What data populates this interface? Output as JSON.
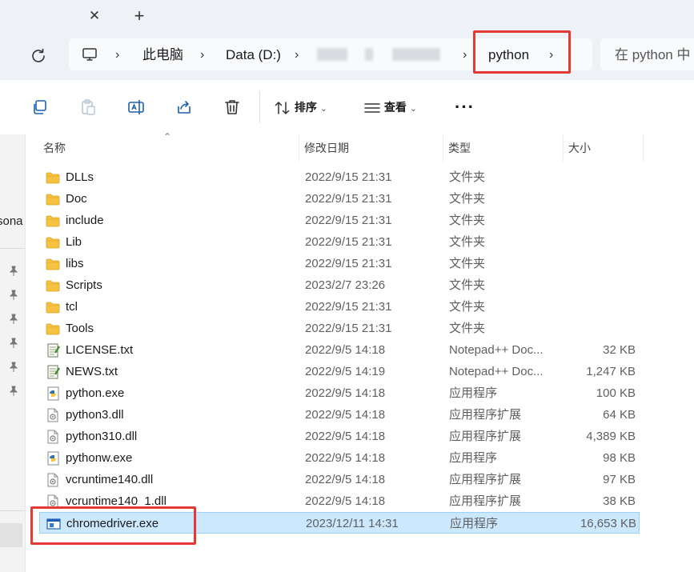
{
  "tabs": {
    "close_glyph": "✕",
    "new_glyph": "+"
  },
  "address": {
    "root_icon": "computer-icon",
    "crumbs": [
      "此电脑",
      "Data (D:)",
      "python"
    ],
    "separator": "›",
    "search_placeholder": "在 python 中"
  },
  "toolbar": {
    "buttons": [
      "copy-icon",
      "paste-icon",
      "rename-icon",
      "share-icon",
      "delete-icon"
    ],
    "sort_label": "排序",
    "view_label": "查看",
    "more_label": "···",
    "dropdown_glyph": "⌄"
  },
  "nav": {
    "partial_label": "sona"
  },
  "columns": {
    "name": "名称",
    "date": "修改日期",
    "type": "类型",
    "size": "大小",
    "sort_glyph": "⌃"
  },
  "files": [
    {
      "name": "DLLs",
      "date": "2022/9/15 21:31",
      "type": "文件夹",
      "size": "",
      "icon": "folder-icon"
    },
    {
      "name": "Doc",
      "date": "2022/9/15 21:31",
      "type": "文件夹",
      "size": "",
      "icon": "folder-icon"
    },
    {
      "name": "include",
      "date": "2022/9/15 21:31",
      "type": "文件夹",
      "size": "",
      "icon": "folder-icon"
    },
    {
      "name": "Lib",
      "date": "2022/9/15 21:31",
      "type": "文件夹",
      "size": "",
      "icon": "folder-icon"
    },
    {
      "name": "libs",
      "date": "2022/9/15 21:31",
      "type": "文件夹",
      "size": "",
      "icon": "folder-icon"
    },
    {
      "name": "Scripts",
      "date": "2023/2/7 23:26",
      "type": "文件夹",
      "size": "",
      "icon": "folder-icon"
    },
    {
      "name": "tcl",
      "date": "2022/9/15 21:31",
      "type": "文件夹",
      "size": "",
      "icon": "folder-icon"
    },
    {
      "name": "Tools",
      "date": "2022/9/15 21:31",
      "type": "文件夹",
      "size": "",
      "icon": "folder-icon"
    },
    {
      "name": "LICENSE.txt",
      "date": "2022/9/5 14:18",
      "type": "Notepad++ Doc...",
      "size": "32 KB",
      "icon": "notepad-file-icon"
    },
    {
      "name": "NEWS.txt",
      "date": "2022/9/5 14:19",
      "type": "Notepad++ Doc...",
      "size": "1,247 KB",
      "icon": "notepad-file-icon"
    },
    {
      "name": "python.exe",
      "date": "2022/9/5 14:18",
      "type": "应用程序",
      "size": "100 KB",
      "icon": "python-exe-icon"
    },
    {
      "name": "python3.dll",
      "date": "2022/9/5 14:18",
      "type": "应用程序扩展",
      "size": "64 KB",
      "icon": "dll-file-icon"
    },
    {
      "name": "python310.dll",
      "date": "2022/9/5 14:18",
      "type": "应用程序扩展",
      "size": "4,389 KB",
      "icon": "dll-file-icon"
    },
    {
      "name": "pythonw.exe",
      "date": "2022/9/5 14:18",
      "type": "应用程序",
      "size": "98 KB",
      "icon": "python-exe-icon"
    },
    {
      "name": "vcruntime140.dll",
      "date": "2022/9/5 14:18",
      "type": "应用程序扩展",
      "size": "97 KB",
      "icon": "dll-file-icon"
    },
    {
      "name": "vcruntime140_1.dll",
      "date": "2022/9/5 14:18",
      "type": "应用程序扩展",
      "size": "38 KB",
      "icon": "dll-file-icon"
    },
    {
      "name": "chromedriver.exe",
      "date": "2023/12/11 14:31",
      "type": "应用程序",
      "size": "16,653 KB",
      "icon": "exe-app-icon",
      "selected": true
    }
  ],
  "colors": {
    "accent_red": "#e53935",
    "selection": "#cce8ff",
    "folder": "#f5c242"
  }
}
